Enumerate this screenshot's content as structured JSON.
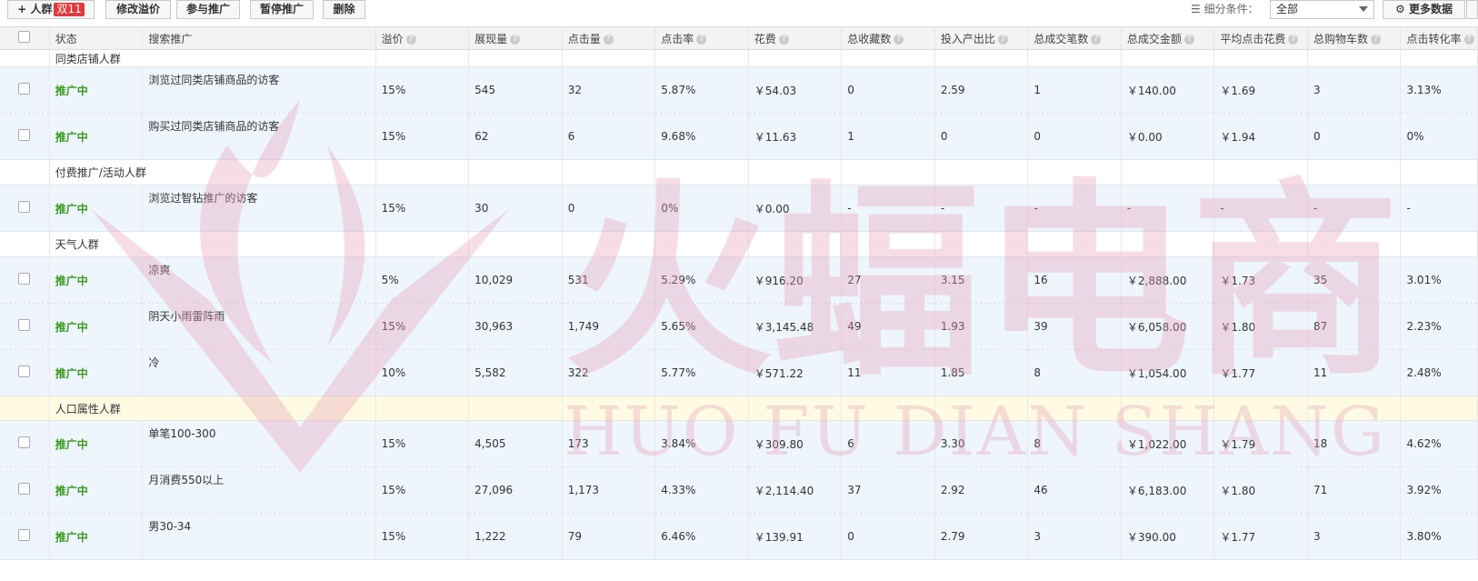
{
  "toolbar": {
    "add_label": "+ 人群",
    "badge": "双11",
    "edit_label": "修改溢价",
    "join_label": "参与推广",
    "pause_label": "暂停推广",
    "delete_label": "删除",
    "filter_label": "细分条件：",
    "filter_value": "全部",
    "more_label": "更多数据"
  },
  "columns": [
    "状态",
    "搜索推广",
    "溢价",
    "展现量",
    "点击量",
    "点击率",
    "花费",
    "总收藏数",
    "投入产出比",
    "总成交笔数",
    "总成交金额",
    "平均点击花费",
    "总购物车数",
    "点击转化率"
  ],
  "rows": [
    {
      "type": "group",
      "name": "同类店铺人群"
    },
    {
      "type": "data",
      "status": "推广中",
      "name": "浏览过同类店铺商品的访客",
      "premium": "15%",
      "impressions": "545",
      "clicks": "32",
      "ctr": "5.87%",
      "cost": "￥54.03",
      "favorites": "0",
      "roi": "2.59",
      "orders": "1",
      "gmv": "￥140.00",
      "cpc": "￥1.69",
      "cart": "3",
      "cvr": "3.13%"
    },
    {
      "type": "data",
      "status": "推广中",
      "name": "购买过同类店铺商品的访客",
      "premium": "15%",
      "impressions": "62",
      "clicks": "6",
      "ctr": "9.68%",
      "cost": "￥11.63",
      "favorites": "1",
      "roi": "0",
      "orders": "0",
      "gmv": "￥0.00",
      "cpc": "￥1.94",
      "cart": "0",
      "cvr": "0%"
    },
    {
      "type": "group",
      "name": "付费推广/活动人群"
    },
    {
      "type": "data",
      "status": "推广中",
      "name": "浏览过智钻推广的访客",
      "premium": "15%",
      "impressions": "30",
      "clicks": "0",
      "ctr": "0%",
      "cost": "￥0.00",
      "favorites": "-",
      "roi": "-",
      "orders": "-",
      "gmv": "-",
      "cpc": "-",
      "cart": "-",
      "cvr": "-"
    },
    {
      "type": "group",
      "name": "天气人群"
    },
    {
      "type": "data",
      "status": "推广中",
      "name": "凉爽",
      "premium": "5%",
      "impressions": "10,029",
      "clicks": "531",
      "ctr": "5.29%",
      "cost": "￥916.20",
      "favorites": "27",
      "roi": "3.15",
      "orders": "16",
      "gmv": "￥2,888.00",
      "cpc": "￥1.73",
      "cart": "35",
      "cvr": "3.01%"
    },
    {
      "type": "data",
      "status": "推广中",
      "name": "阴天小雨雷阵雨",
      "premium": "15%",
      "impressions": "30,963",
      "clicks": "1,749",
      "ctr": "5.65%",
      "cost": "￥3,145.48",
      "favorites": "49",
      "roi": "1.93",
      "orders": "39",
      "gmv": "￥6,058.00",
      "cpc": "￥1.80",
      "cart": "87",
      "cvr": "2.23%"
    },
    {
      "type": "data",
      "status": "推广中",
      "name": "冷",
      "premium": "10%",
      "impressions": "5,582",
      "clicks": "322",
      "ctr": "5.77%",
      "cost": "￥571.22",
      "favorites": "11",
      "roi": "1.85",
      "orders": "8",
      "gmv": "￥1,054.00",
      "cpc": "￥1.77",
      "cart": "11",
      "cvr": "2.48%"
    },
    {
      "type": "group",
      "name": "人口属性人群",
      "highlight": true
    },
    {
      "type": "data",
      "status": "推广中",
      "name": "单笔100-300",
      "premium": "15%",
      "impressions": "4,505",
      "clicks": "173",
      "ctr": "3.84%",
      "cost": "￥309.80",
      "favorites": "6",
      "roi": "3.30",
      "orders": "8",
      "gmv": "￥1,022.00",
      "cpc": "￥1.79",
      "cart": "18",
      "cvr": "4.62%"
    },
    {
      "type": "data",
      "status": "推广中",
      "name": "月消费550以上",
      "premium": "15%",
      "impressions": "27,096",
      "clicks": "1,173",
      "ctr": "4.33%",
      "cost": "￥2,114.40",
      "favorites": "37",
      "roi": "2.92",
      "orders": "46",
      "gmv": "￥6,183.00",
      "cpc": "￥1.80",
      "cart": "71",
      "cvr": "3.92%"
    },
    {
      "type": "data",
      "status": "推广中",
      "name": "男30-34",
      "premium": "15%",
      "impressions": "1,222",
      "clicks": "79",
      "ctr": "6.46%",
      "cost": "￥139.91",
      "favorites": "0",
      "roi": "2.79",
      "orders": "3",
      "gmv": "￥390.00",
      "cpc": "￥1.77",
      "cart": "3",
      "cvr": "3.80%"
    }
  ],
  "watermark": {
    "cn": "火蝠电商",
    "en": "HUO FU DIAN SHANG",
    "color": "#e8a0b4"
  }
}
